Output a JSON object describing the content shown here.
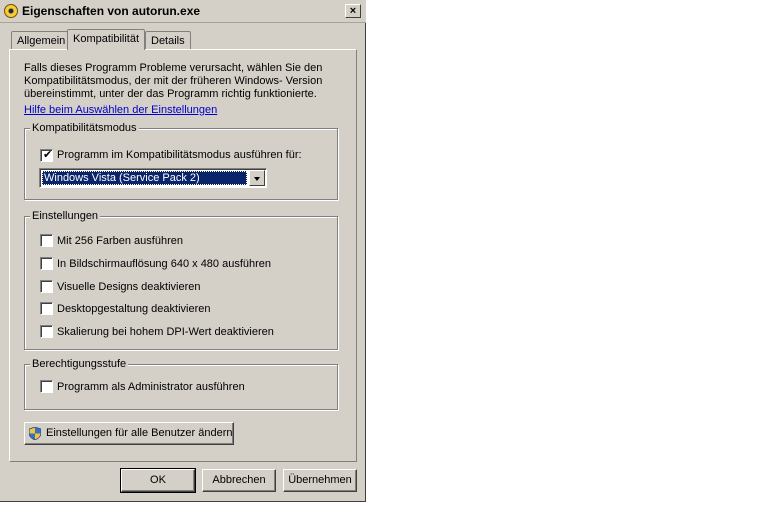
{
  "window": {
    "title": "Eigenschaften von autorun.exe",
    "close_glyph": "×"
  },
  "tabs": [
    {
      "label": "Allgemein",
      "active": false
    },
    {
      "label": "Kompatibilität",
      "active": true
    },
    {
      "label": "Details",
      "active": false
    }
  ],
  "intro": {
    "text": "Falls dieses Programm Probleme verursacht, wählen Sie den Kompatibilitätsmodus, der mit der früheren Windows- Version übereinstimmt, unter der das Programm richtig funktionierte.",
    "help_link": "Hilfe beim Auswählen der Einstellungen"
  },
  "compat_mode": {
    "group_label": "Kompatibilitätsmodus",
    "checkbox_label": "Programm im Kompatibilitätsmodus ausführen für:",
    "checked": true,
    "selected_os": "Windows Vista (Service Pack 2)"
  },
  "settings": {
    "group_label": "Einstellungen",
    "items": [
      {
        "label": "Mit 256 Farben ausführen",
        "checked": false
      },
      {
        "label": "In Bildschirmauflösung 640 x 480 ausführen",
        "checked": false
      },
      {
        "label": "Visuelle Designs deaktivieren",
        "checked": false
      },
      {
        "label": "Desktopgestaltung deaktivieren",
        "checked": false
      },
      {
        "label": "Skalierung bei hohem DPI-Wert deaktivieren",
        "checked": false
      }
    ]
  },
  "privilege": {
    "group_label": "Berechtigungsstufe",
    "checkbox_label": "Programm als Administrator ausführen",
    "checked": false
  },
  "all_users_button": "Einstellungen für alle Benutzer ändern",
  "footer": {
    "ok": "OK",
    "cancel": "Abbrechen",
    "apply": "Übernehmen"
  },
  "colors": {
    "dialog_bg": "#d4d0c8",
    "selection": "#0a246a",
    "link": "#0000cc"
  },
  "icons": {
    "title_icon": "cd-disc-icon",
    "button_icon": "uac-shield-icon",
    "check_glyph": "✔"
  }
}
